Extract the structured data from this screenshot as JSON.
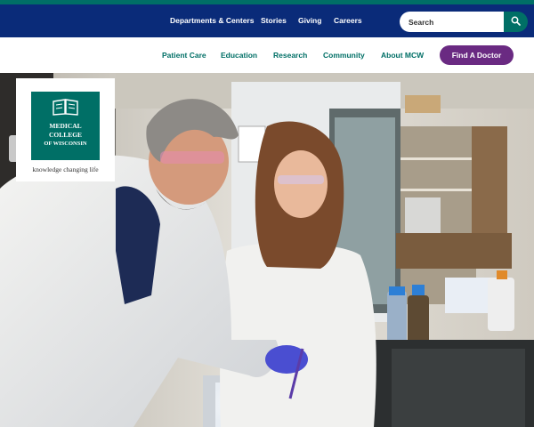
{
  "logo": {
    "line1": "MEDICAL",
    "line2": "COLLEGE",
    "line3": "OF WISCONSIN",
    "tagline": "knowledge changing life"
  },
  "utility_nav": {
    "links": [
      "Departments & Centers",
      "Stories",
      "Giving",
      "Careers"
    ]
  },
  "search": {
    "placeholder": "Search"
  },
  "main_nav": {
    "links": [
      "Patient Care",
      "Education",
      "Research",
      "Community",
      "About MCW"
    ],
    "cta_label": "Find A Doctor"
  },
  "colors": {
    "utility_bar": "#0a2b79",
    "brand_green": "#006f66",
    "cta_purple": "#6a2a82"
  },
  "icons": {
    "search": "search-icon",
    "logo": "book-icon"
  }
}
